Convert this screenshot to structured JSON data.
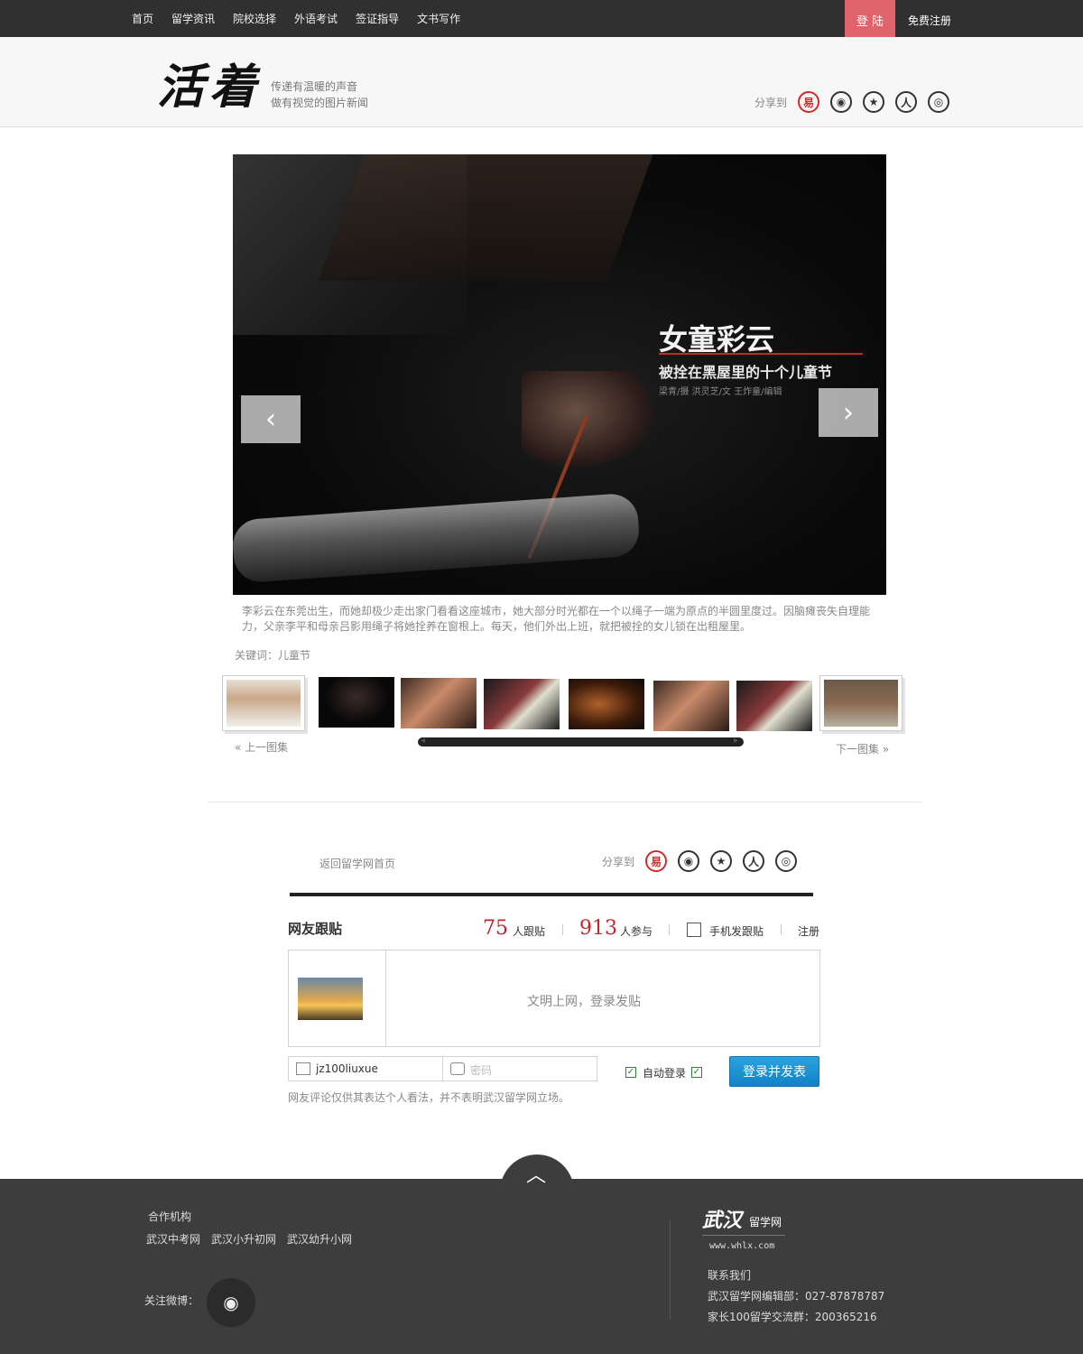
{
  "nav": {
    "items": [
      "首页",
      "留学资讯",
      "院校选择",
      "外语考试",
      "签证指导",
      "文书写作"
    ],
    "login": "登 陆",
    "register": "免费注册"
  },
  "header": {
    "logo": "活着",
    "slogan_line1": "传递有温暖的声音",
    "slogan_line2": "做有视觉的图片新闻",
    "share_label": "分享到"
  },
  "share_icons": [
    "netease-weibo-icon",
    "sina-weibo-icon",
    "star-icon",
    "renren-icon",
    "kaixin-icon"
  ],
  "photo": {
    "overlay_title": "女童彩云",
    "overlay_subtitle": "被拴在黑屋里的十个儿童节",
    "overlay_credit": "梁青/摄 洪灵芝/文 王炸童/编辑",
    "caption": "李彩云在东莞出生，而她却极少走出家门看看这座城市，她大部分时光都在一个以绳子一端为原点的半圆里度过。因脑瘫丧失自理能力，父亲李平和母亲吕影用绳子将她拴养在窗根上。每天，他们外出上班，就把被拴的女儿锁在出租屋里。",
    "keywords": "关键词：儿童节"
  },
  "thumbs": {
    "prev_set": "上一图集",
    "next_set": "下一图集"
  },
  "bottom_bar": {
    "back_home": "返回留学网首页",
    "share_label": "分享到"
  },
  "comments": {
    "title": "网友跟贴",
    "followers_count": "75",
    "followers_label": "人跟贴",
    "participants_count": "913",
    "participants_label": "人参与",
    "mobile_post": "手机发跟贴",
    "register": "注册",
    "placeholder": "文明上网，登录发贴",
    "username_value": "jz100liuxue",
    "password_placeholder": "密码",
    "auto_login": "自动登录",
    "submit": "登录并发表",
    "disclaimer": "网友评论仅供其表达个人看法，并不表明武汉留学网立场。"
  },
  "footer": {
    "partners_title": "合作机构",
    "partners": [
      "武汉中考网",
      "武汉小升初网",
      "武汉幼升小网"
    ],
    "follow_weibo": "关注微博：",
    "logo_main": "武汉",
    "logo_small": "留学网",
    "url": "www.whlx.com",
    "contact_title": "联系我们",
    "contact_editor": "武汉留学网编辑部：027-87878787",
    "contact_group": "家长100留学交流群：200365216"
  }
}
